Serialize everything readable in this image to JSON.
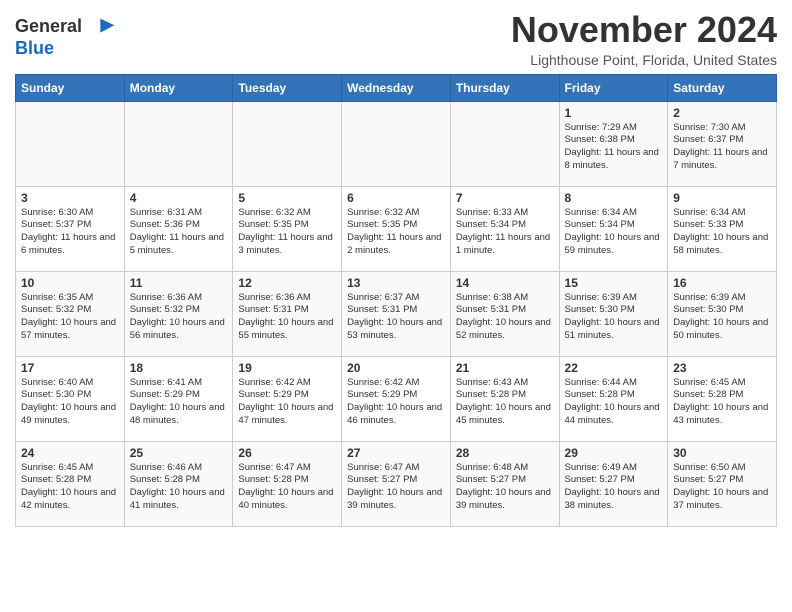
{
  "header": {
    "logo_line1": "General",
    "logo_line2": "Blue",
    "title": "November 2024",
    "subtitle": "Lighthouse Point, Florida, United States"
  },
  "weekdays": [
    "Sunday",
    "Monday",
    "Tuesday",
    "Wednesday",
    "Thursday",
    "Friday",
    "Saturday"
  ],
  "weeks": [
    [
      {
        "day": "",
        "info": ""
      },
      {
        "day": "",
        "info": ""
      },
      {
        "day": "",
        "info": ""
      },
      {
        "day": "",
        "info": ""
      },
      {
        "day": "",
        "info": ""
      },
      {
        "day": "1",
        "info": "Sunrise: 7:29 AM\nSunset: 6:38 PM\nDaylight: 11 hours and 8 minutes."
      },
      {
        "day": "2",
        "info": "Sunrise: 7:30 AM\nSunset: 6:37 PM\nDaylight: 11 hours and 7 minutes."
      }
    ],
    [
      {
        "day": "3",
        "info": "Sunrise: 6:30 AM\nSunset: 5:37 PM\nDaylight: 11 hours and 6 minutes."
      },
      {
        "day": "4",
        "info": "Sunrise: 6:31 AM\nSunset: 5:36 PM\nDaylight: 11 hours and 5 minutes."
      },
      {
        "day": "5",
        "info": "Sunrise: 6:32 AM\nSunset: 5:35 PM\nDaylight: 11 hours and 3 minutes."
      },
      {
        "day": "6",
        "info": "Sunrise: 6:32 AM\nSunset: 5:35 PM\nDaylight: 11 hours and 2 minutes."
      },
      {
        "day": "7",
        "info": "Sunrise: 6:33 AM\nSunset: 5:34 PM\nDaylight: 11 hours and 1 minute."
      },
      {
        "day": "8",
        "info": "Sunrise: 6:34 AM\nSunset: 5:34 PM\nDaylight: 10 hours and 59 minutes."
      },
      {
        "day": "9",
        "info": "Sunrise: 6:34 AM\nSunset: 5:33 PM\nDaylight: 10 hours and 58 minutes."
      }
    ],
    [
      {
        "day": "10",
        "info": "Sunrise: 6:35 AM\nSunset: 5:32 PM\nDaylight: 10 hours and 57 minutes."
      },
      {
        "day": "11",
        "info": "Sunrise: 6:36 AM\nSunset: 5:32 PM\nDaylight: 10 hours and 56 minutes."
      },
      {
        "day": "12",
        "info": "Sunrise: 6:36 AM\nSunset: 5:31 PM\nDaylight: 10 hours and 55 minutes."
      },
      {
        "day": "13",
        "info": "Sunrise: 6:37 AM\nSunset: 5:31 PM\nDaylight: 10 hours and 53 minutes."
      },
      {
        "day": "14",
        "info": "Sunrise: 6:38 AM\nSunset: 5:31 PM\nDaylight: 10 hours and 52 minutes."
      },
      {
        "day": "15",
        "info": "Sunrise: 6:39 AM\nSunset: 5:30 PM\nDaylight: 10 hours and 51 minutes."
      },
      {
        "day": "16",
        "info": "Sunrise: 6:39 AM\nSunset: 5:30 PM\nDaylight: 10 hours and 50 minutes."
      }
    ],
    [
      {
        "day": "17",
        "info": "Sunrise: 6:40 AM\nSunset: 5:30 PM\nDaylight: 10 hours and 49 minutes."
      },
      {
        "day": "18",
        "info": "Sunrise: 6:41 AM\nSunset: 5:29 PM\nDaylight: 10 hours and 48 minutes."
      },
      {
        "day": "19",
        "info": "Sunrise: 6:42 AM\nSunset: 5:29 PM\nDaylight: 10 hours and 47 minutes."
      },
      {
        "day": "20",
        "info": "Sunrise: 6:42 AM\nSunset: 5:29 PM\nDaylight: 10 hours and 46 minutes."
      },
      {
        "day": "21",
        "info": "Sunrise: 6:43 AM\nSunset: 5:28 PM\nDaylight: 10 hours and 45 minutes."
      },
      {
        "day": "22",
        "info": "Sunrise: 6:44 AM\nSunset: 5:28 PM\nDaylight: 10 hours and 44 minutes."
      },
      {
        "day": "23",
        "info": "Sunrise: 6:45 AM\nSunset: 5:28 PM\nDaylight: 10 hours and 43 minutes."
      }
    ],
    [
      {
        "day": "24",
        "info": "Sunrise: 6:45 AM\nSunset: 5:28 PM\nDaylight: 10 hours and 42 minutes."
      },
      {
        "day": "25",
        "info": "Sunrise: 6:46 AM\nSunset: 5:28 PM\nDaylight: 10 hours and 41 minutes."
      },
      {
        "day": "26",
        "info": "Sunrise: 6:47 AM\nSunset: 5:28 PM\nDaylight: 10 hours and 40 minutes."
      },
      {
        "day": "27",
        "info": "Sunrise: 6:47 AM\nSunset: 5:27 PM\nDaylight: 10 hours and 39 minutes."
      },
      {
        "day": "28",
        "info": "Sunrise: 6:48 AM\nSunset: 5:27 PM\nDaylight: 10 hours and 39 minutes."
      },
      {
        "day": "29",
        "info": "Sunrise: 6:49 AM\nSunset: 5:27 PM\nDaylight: 10 hours and 38 minutes."
      },
      {
        "day": "30",
        "info": "Sunrise: 6:50 AM\nSunset: 5:27 PM\nDaylight: 10 hours and 37 minutes."
      }
    ]
  ]
}
